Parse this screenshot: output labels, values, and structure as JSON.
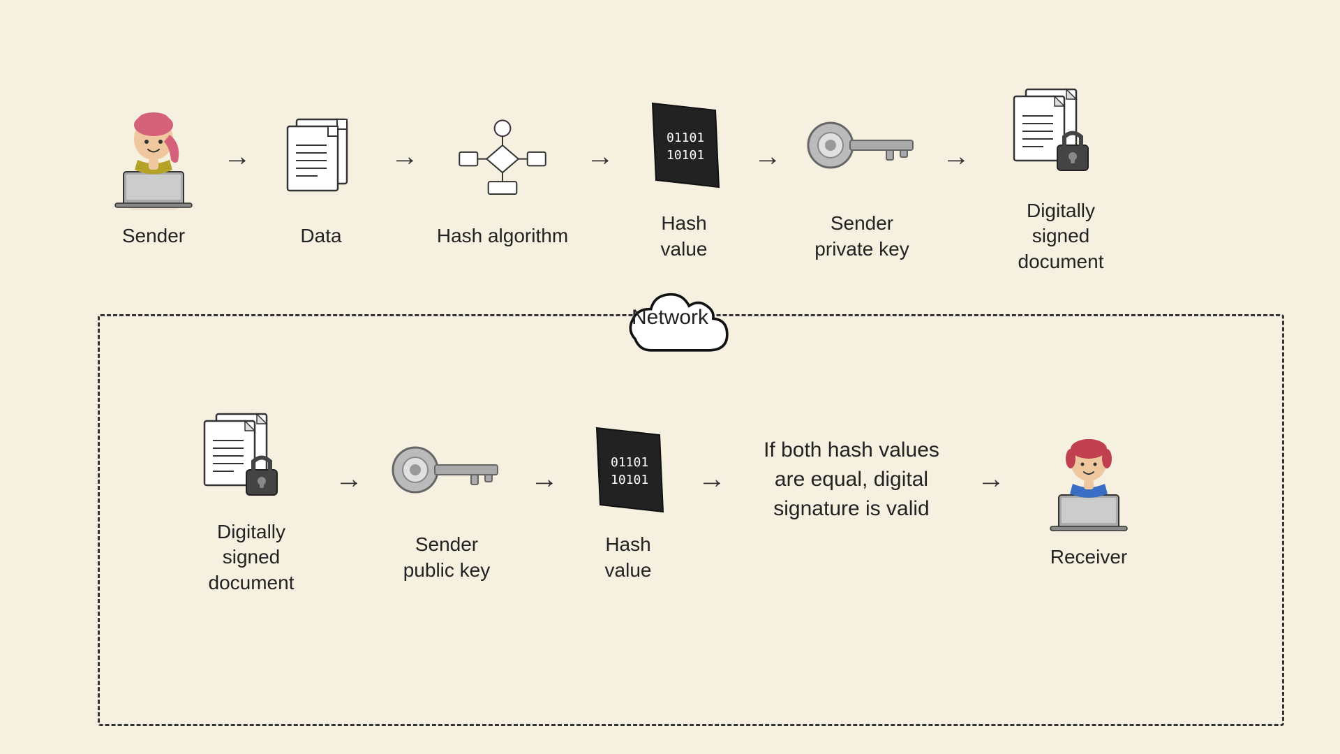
{
  "labels": {
    "sender": "Sender",
    "data": "Data",
    "hash_algorithm": "Hash algorithm",
    "hash_value_top": "Hash\nvalue",
    "sender_private_key": "Sender\nprivate key",
    "digitally_signed_top": "Digitally\nsigned\ndocument",
    "network": "Network",
    "digitally_signed_bottom": "Digitally\nsigned\ndocument",
    "sender_public_key": "Sender\npublic key",
    "hash_value_bottom": "Hash\nvalue",
    "if_equal": "If both hash values\nare equal, digital\nsignature is valid",
    "receiver": "Receiver"
  },
  "hash_binary": "01101\n10101",
  "hash_binary2": "01101\n10101"
}
